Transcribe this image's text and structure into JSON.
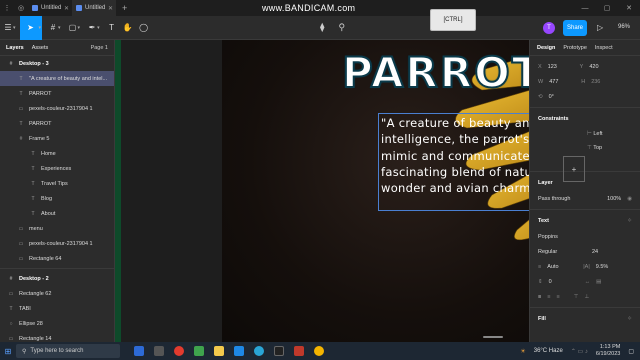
{
  "browser": {
    "tabs": [
      {
        "label": "Untitled",
        "active": false
      },
      {
        "label": "Untitled",
        "active": true
      }
    ],
    "add_tab": "+",
    "watermark": "www.BANDICAM.com",
    "window_controls": [
      "—",
      "▢",
      "✕"
    ]
  },
  "overlay": {
    "key_hint": "[CTRL]"
  },
  "toolbar": {
    "avatar_initial": "T",
    "share_label": "Share",
    "zoom_label": "96%"
  },
  "left_panel": {
    "tabs": {
      "layers": "Layers",
      "assets": "Assets"
    },
    "page_label": "Page 1",
    "layers": [
      {
        "label": "Desktop - 3",
        "level": 0,
        "icon": "#",
        "bold": true,
        "selected": false
      },
      {
        "label": "\"A creature of beauty and intel...",
        "level": 1,
        "icon": "T",
        "bold": false,
        "selected": true
      },
      {
        "label": "PARROT",
        "level": 1,
        "icon": "T",
        "bold": false,
        "selected": false
      },
      {
        "label": "pexels-couleur-2317904 1",
        "level": 1,
        "icon": "▭",
        "bold": false,
        "selected": false
      },
      {
        "label": "PARROT",
        "level": 1,
        "icon": "T",
        "bold": false,
        "selected": false
      },
      {
        "label": "Frame 5",
        "level": 1,
        "icon": "#",
        "bold": false,
        "selected": false
      },
      {
        "label": "Home",
        "level": 2,
        "icon": "T",
        "bold": false,
        "selected": false
      },
      {
        "label": "Experiences",
        "level": 2,
        "icon": "T",
        "bold": false,
        "selected": false
      },
      {
        "label": "Travel Tips",
        "level": 2,
        "icon": "T",
        "bold": false,
        "selected": false
      },
      {
        "label": "Blog",
        "level": 2,
        "icon": "T",
        "bold": false,
        "selected": false
      },
      {
        "label": "About",
        "level": 2,
        "icon": "T",
        "bold": false,
        "selected": false
      },
      {
        "label": "menu",
        "level": 1,
        "icon": "▭",
        "bold": false,
        "selected": false
      },
      {
        "label": "pexels-couleur-2317904 1",
        "level": 1,
        "icon": "▭",
        "bold": false,
        "selected": false
      },
      {
        "label": "Rectangle 64",
        "level": 1,
        "icon": "▭",
        "bold": false,
        "selected": false
      },
      {
        "label": "Desktop - 2",
        "level": 0,
        "icon": "#",
        "bold": true,
        "selected": false
      },
      {
        "label": "Rectangle 62",
        "level": 0,
        "icon": "▭",
        "bold": false,
        "selected": false
      },
      {
        "label": "TABI",
        "level": 0,
        "icon": "T",
        "bold": false,
        "selected": false
      },
      {
        "label": "Ellipse 28",
        "level": 0,
        "icon": "○",
        "bold": false,
        "selected": false
      },
      {
        "label": "Rectangle 14",
        "level": 0,
        "icon": "▭",
        "bold": false,
        "selected": false
      }
    ]
  },
  "canvas": {
    "title_text": "PARROT",
    "quote_text": "\"A creature of beauty and intelligence, the parrot's ability to mimic and communicate reflects a fascinating blend of nature's wonder and avian charm.\""
  },
  "right_panel": {
    "tabs": {
      "design": "Design",
      "prototype": "Prototype",
      "inspect": "Inspect"
    },
    "x_label": "X",
    "x_value": "123",
    "y_label": "Y",
    "y_value": "420",
    "w_label": "W",
    "w_value": "477",
    "h_label": "H",
    "h_value": "236",
    "rotation": "0°",
    "constraints_title": "Constraints",
    "constraint_h": "Left",
    "constraint_v": "Top",
    "layer_title": "Layer",
    "blend_mode": "Pass through",
    "opacity": "100%",
    "text_title": "Text",
    "font_family": "Poppins",
    "font_weight": "Regular",
    "font_size": "24",
    "line_height": "Auto",
    "letter_spacing": "9.5%",
    "paragraph_spacing": "0",
    "fill_title": "Fill"
  },
  "taskbar": {
    "search_placeholder": "Type here to search",
    "weather": "36°C  Haze",
    "time": "1:13 PM",
    "date": "6/19/2023"
  },
  "colors": {
    "accent": "#0d99ff",
    "selection": "#4a4f6e",
    "text_box_border": "#4a7fd1"
  }
}
